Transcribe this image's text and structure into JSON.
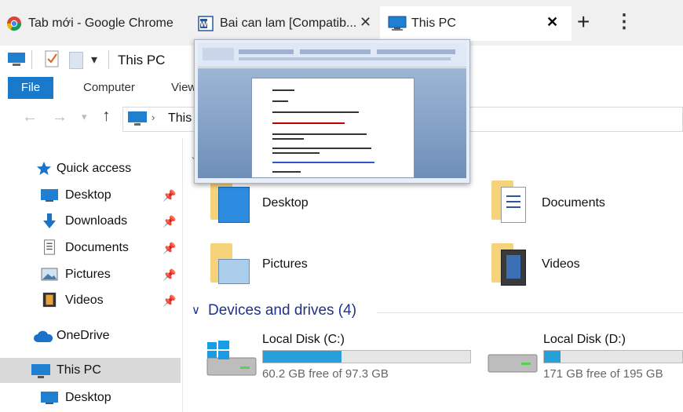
{
  "browser": {
    "tabs": [
      {
        "label": "Tab mới - Google Chrome",
        "icon": "chrome-icon"
      },
      {
        "label": "Bai can lam [Compatib...",
        "icon": "word-icon"
      },
      {
        "label": "This PC",
        "icon": "computer-icon",
        "active": true
      }
    ],
    "new_tab_glyph": "+",
    "menu_glyph": "⋮",
    "close_glyph": "✕",
    "close_glyph_active": "✕"
  },
  "explorer": {
    "window_title": "This PC",
    "ribbon_tabs": [
      "File",
      "Computer",
      "View"
    ],
    "address": "This PC",
    "nav": [
      {
        "label": "Quick access",
        "icon": "star-icon",
        "pinned": false
      },
      {
        "label": "Desktop",
        "icon": "desktop-icon",
        "pinned": true
      },
      {
        "label": "Downloads",
        "icon": "download-icon",
        "pinned": true
      },
      {
        "label": "Documents",
        "icon": "documents-icon",
        "pinned": true
      },
      {
        "label": "Pictures",
        "icon": "pictures-icon",
        "pinned": true
      },
      {
        "label": "Videos",
        "icon": "videos-icon",
        "pinned": true
      },
      {
        "label": "OneDrive",
        "icon": "onedrive-icon",
        "pinned": false
      },
      {
        "label": "This PC",
        "icon": "computer-icon",
        "pinned": false,
        "selected": true
      },
      {
        "label": "Desktop",
        "icon": "desktop-icon",
        "pinned": false
      }
    ],
    "folders": [
      {
        "label": "Desktop"
      },
      {
        "label": "Documents"
      },
      {
        "label": "Pictures"
      },
      {
        "label": "Videos"
      }
    ],
    "devices_header": "Devices and drives (4)",
    "drives": [
      {
        "label": "Local Disk (C:)",
        "free_text": "60.2 GB free of 97.3 GB",
        "used_fraction": 0.38
      },
      {
        "label": "Local Disk (D:)",
        "free_text": "171 GB free of 195 GB",
        "used_fraction": 0.12
      }
    ]
  },
  "colors": {
    "accent": "#1979ca",
    "drive_fill": "#26a0da",
    "header_blue": "#1e3287"
  }
}
